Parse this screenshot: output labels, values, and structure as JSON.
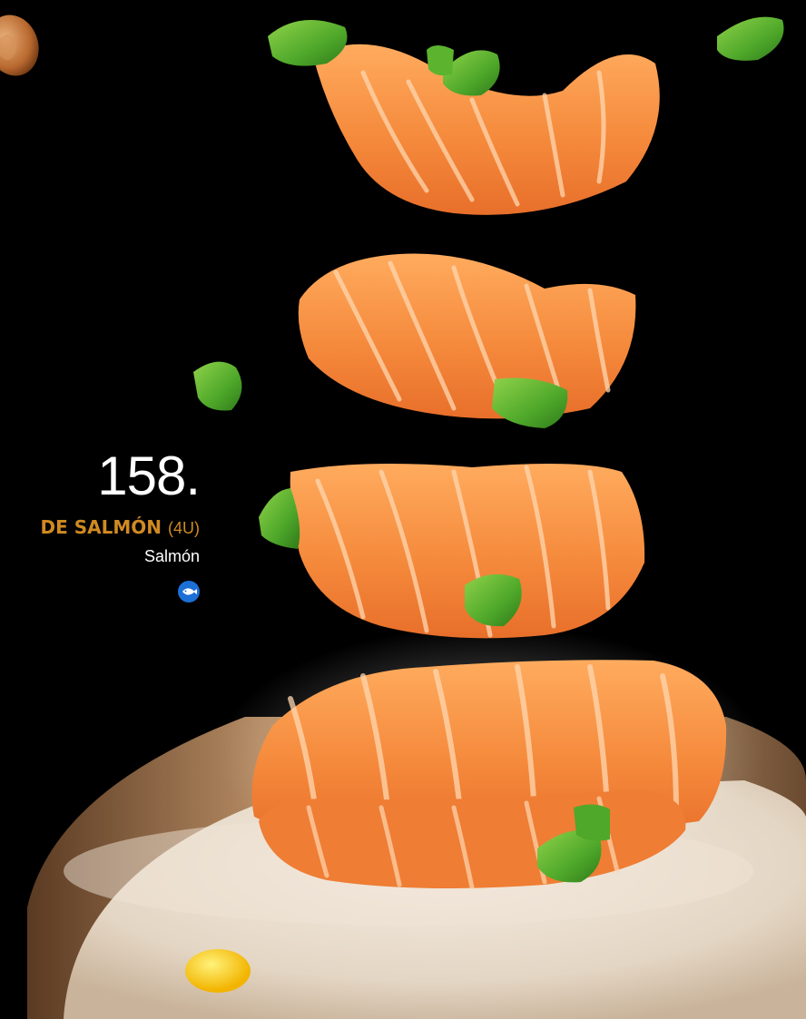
{
  "menu_item": {
    "number": "158.",
    "name": "DE SALMÓN",
    "quantity": "(4U)",
    "description": "Salmón",
    "allergen_icon": "fish-icon"
  },
  "colors": {
    "background": "#000000",
    "name_accent": "#d08a22",
    "salmon": "#f58a3c",
    "scallion": "#4fa82a",
    "allergen_blue": "#1c6fd6"
  }
}
